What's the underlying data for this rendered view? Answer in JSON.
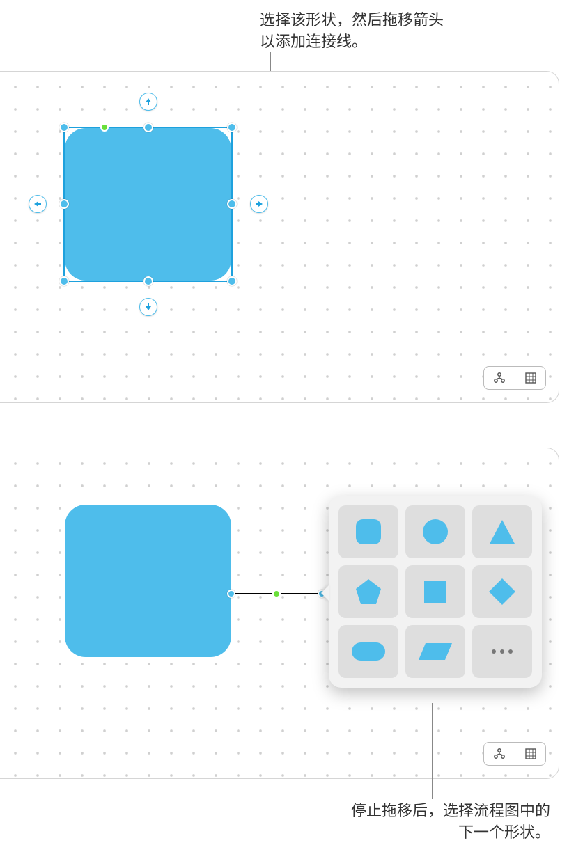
{
  "callouts": {
    "top": "选择该形状，然后拖移箭头\n以添加连接线。",
    "bottom": "停止拖移后，选择流程图中的\n下一个形状。"
  },
  "toolbar": {
    "mode_icon": "diagram-mode-icon",
    "grid_icon": "grid-toggle-icon"
  },
  "shape_picker": {
    "options": [
      "rounded-square",
      "circle",
      "triangle",
      "pentagon",
      "square",
      "diamond",
      "capsule",
      "parallelogram",
      "more"
    ]
  },
  "colors": {
    "shape_fill": "#4ebdeb",
    "handle_green": "#6adf3a"
  }
}
